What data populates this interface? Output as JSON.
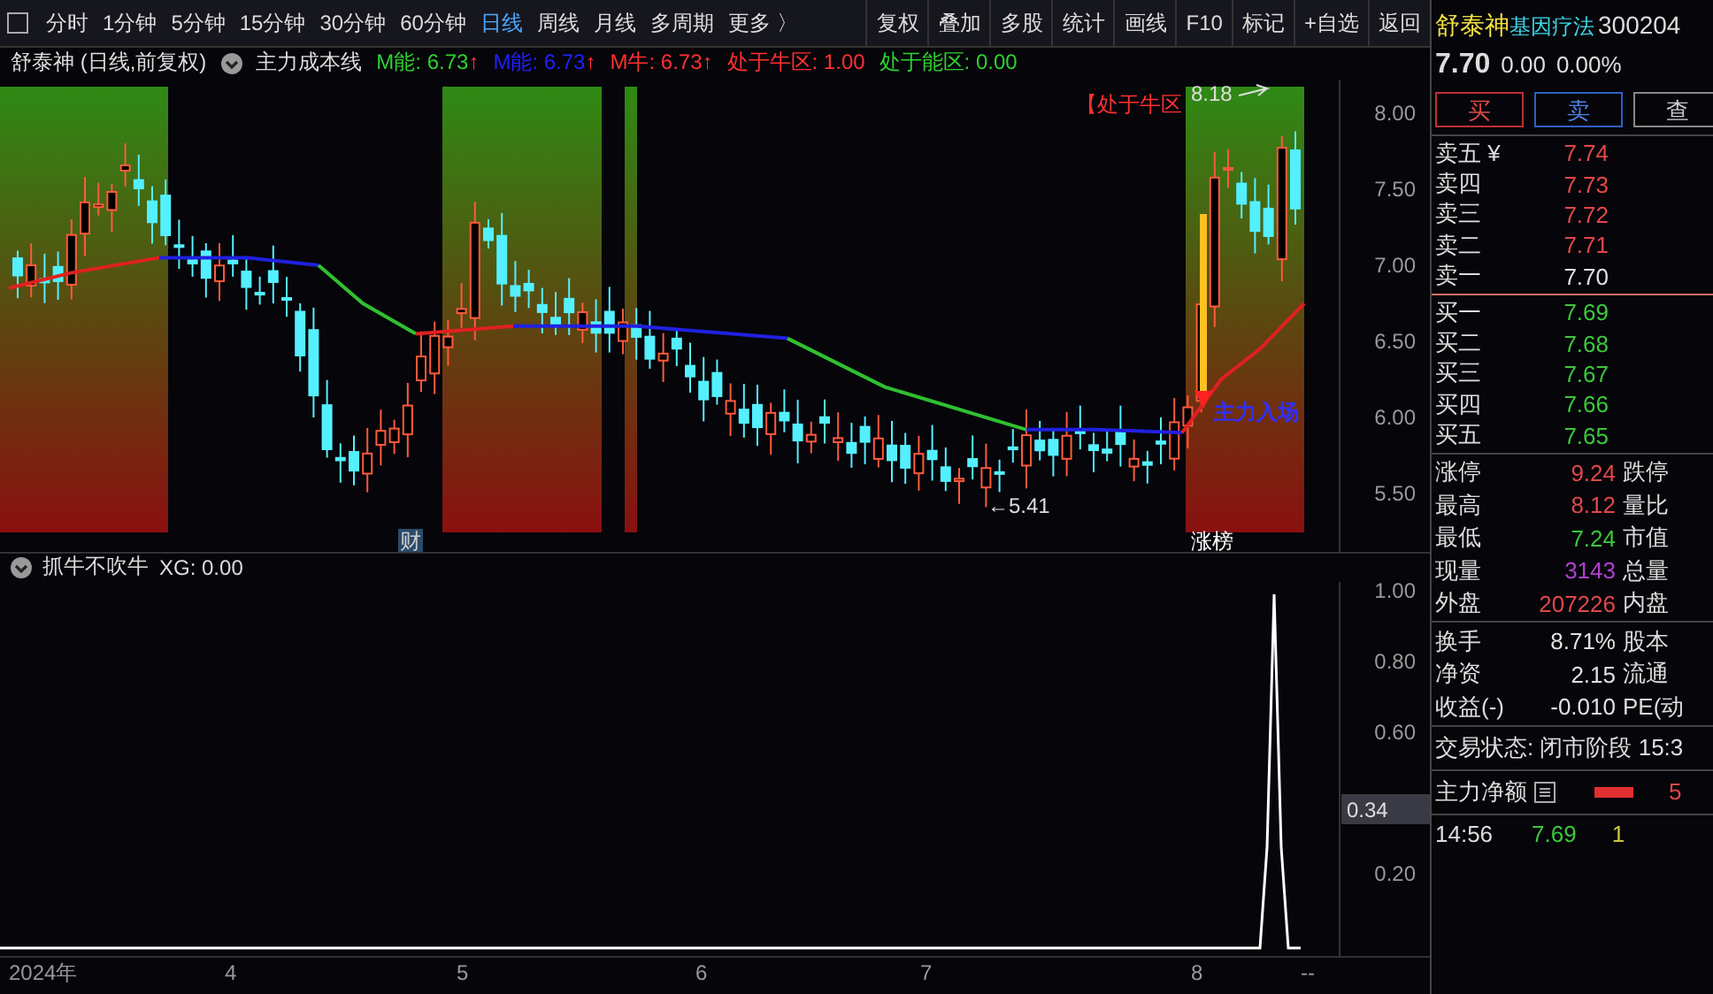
{
  "toolbar": {
    "periods": [
      {
        "label": "分时",
        "selected": false
      },
      {
        "label": "1分钟",
        "selected": false
      },
      {
        "label": "5分钟",
        "selected": false
      },
      {
        "label": "15分钟",
        "selected": false
      },
      {
        "label": "30分钟",
        "selected": false
      },
      {
        "label": "60分钟",
        "selected": false
      },
      {
        "label": "日线",
        "selected": true
      },
      {
        "label": "周线",
        "selected": false
      },
      {
        "label": "月线",
        "selected": false
      },
      {
        "label": "多周期",
        "selected": false
      },
      {
        "label": "更多 〉",
        "selected": false
      }
    ],
    "actions": [
      "复权",
      "叠加",
      "多股",
      "统计",
      "画线",
      "F10",
      "标记",
      "+自选",
      "返回"
    ]
  },
  "legend": {
    "title": "舒泰神 (日线,前复权)",
    "indicator": "主力成本线",
    "items": [
      {
        "label": "M能: 6.73",
        "arrow": "↑",
        "color": "#30d030"
      },
      {
        "label": "M能: 6.73",
        "arrow": "↑",
        "color": "#2020ff"
      },
      {
        "label": "M牛: 6.73",
        "arrow": "↑",
        "color": "#ff3030"
      },
      {
        "label": "处于牛区: 1.00",
        "color": "#ff3030"
      },
      {
        "label": "处于能区: 0.00",
        "color": "#30d030"
      }
    ]
  },
  "main_chart": {
    "y_labels": [
      "8.00",
      "7.50",
      "7.00",
      "6.50",
      "6.00",
      "5.50"
    ],
    "zone_label": "【处于牛区",
    "high_label": "8.18",
    "low_label": "←5.41",
    "entry_label": "主力入场",
    "markers": [
      "财",
      "涨榜"
    ]
  },
  "indicator": {
    "title": "抓牛不吹牛",
    "value": "XG: 0.00",
    "y_labels": [
      "1.00",
      "0.80",
      "0.60",
      "0.20"
    ],
    "current": "0.34"
  },
  "date_axis": [
    "2024年",
    "4",
    "5",
    "6",
    "7",
    "8",
    "--"
  ],
  "quote": {
    "name": "舒泰神",
    "concept": "基因疗法",
    "code": "300204",
    "price": "7.70",
    "change": "0.00",
    "percent": "0.00%",
    "buttons": [
      {
        "label": "买",
        "kind": "buy"
      },
      {
        "label": "卖",
        "kind": "sell"
      },
      {
        "label": "查",
        "kind": "query"
      }
    ],
    "asks": [
      {
        "label": "卖五 ¥",
        "price": "7.74",
        "color": "#e04848"
      },
      {
        "label": "卖四",
        "price": "7.73",
        "color": "#e04848"
      },
      {
        "label": "卖三",
        "price": "7.72",
        "color": "#e04848"
      },
      {
        "label": "卖二",
        "price": "7.71",
        "color": "#e04848"
      },
      {
        "label": "卖一",
        "price": "7.70",
        "color": "#e0e0e0"
      }
    ],
    "bids": [
      {
        "label": "买一",
        "price": "7.69",
        "color": "#3cc83c"
      },
      {
        "label": "买二",
        "price": "7.68",
        "color": "#3cc83c"
      },
      {
        "label": "买三",
        "price": "7.67",
        "color": "#3cc83c"
      },
      {
        "label": "买四",
        "price": "7.66",
        "color": "#3cc83c"
      },
      {
        "label": "买五",
        "price": "7.65",
        "color": "#3cc83c"
      }
    ],
    "stats": [
      {
        "label": "涨停",
        "value": "9.24",
        "color": "#e04848",
        "right": "跌停"
      },
      {
        "label": "最高",
        "value": "8.12",
        "color": "#e04848",
        "right": "量比"
      },
      {
        "label": "最低",
        "value": "7.24",
        "color": "#3cc83c",
        "right": "市值"
      },
      {
        "label": "现量",
        "value": "3143",
        "color": "#b040d0",
        "right": "总量"
      },
      {
        "label": "外盘",
        "value": "207226",
        "color": "#e04848",
        "right": "内盘"
      }
    ],
    "stats2": [
      {
        "label": "换手",
        "value": "8.71%",
        "color": "#e0e0e0",
        "right": "股本"
      },
      {
        "label": "净资",
        "value": "2.15",
        "color": "#e0e0e0",
        "right": "流通"
      },
      {
        "label": "收益(-)",
        "value": "-0.010",
        "color": "#e0e0e0",
        "right": "PE(动"
      }
    ],
    "status": "交易状态: 闭市阶段 15:3",
    "net_label": "主力净额",
    "net_value": "5",
    "ticks": [
      {
        "time": "14:56",
        "price": "7.69",
        "volume": "1"
      }
    ]
  }
}
